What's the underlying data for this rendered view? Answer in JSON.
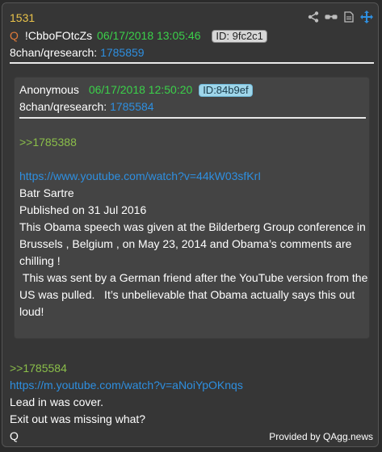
{
  "post": {
    "number": "1531",
    "q_marker": "Q",
    "tripcode": "!CbboFOtcZs",
    "date": "06/17/2018 13:05:46",
    "id": "ID: 9fc2c1",
    "board": "8chan/qresearch:",
    "post_link": "1785859"
  },
  "toolbar": {
    "share_icon": "share-icon",
    "glasses_icon": "glasses-icon",
    "document_icon": "document-icon",
    "move_icon": "move-icon"
  },
  "quoted": {
    "author": "Anonymous",
    "date": "06/17/2018 12:50:20",
    "id": "ID:84b9ef",
    "board": "8chan/qresearch:",
    "post_link": "1785584",
    "reply_ref": ">>1785388",
    "url": "https://www.youtube.com/watch?v=44kW03sfKrI",
    "lines": [
      "Batr Sartre",
      "Published on 31 Jul 2016",
      "This Obama speech was given at the Bilderberg Group conference in Brussels , Belgium , on May 23, 2014 and Obama’s comments are chilling !",
      " This was sent by a German friend after the YouTube version from the US was pulled.   It’s unbelievable that Obama actually says this out loud!"
    ]
  },
  "body": {
    "reply_ref": ">>1785584",
    "url": "https://m.youtube.com/watch?v=aNoiYpOKnqs",
    "lines": [
      "Lead in was cover.",
      "Exit out was missing what?",
      "Q"
    ]
  },
  "footer": "Provided by QAgg.news",
  "colors": {
    "post_number": "#e8c24a",
    "q_marker": "#e07a3a",
    "date": "#3bd14a",
    "link": "#2e8fe0",
    "greentext": "#8bbf4a"
  }
}
